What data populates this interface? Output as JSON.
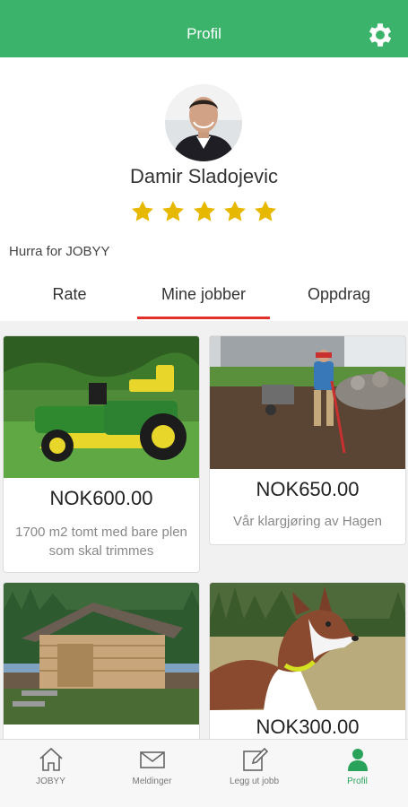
{
  "header": {
    "title": "Profil"
  },
  "profile": {
    "name": "Damir Sladojevic",
    "rating": 5,
    "bio": "Hurra for JOBYY"
  },
  "tabs": [
    {
      "label": "Rate"
    },
    {
      "label": "Mine jobber",
      "active": true
    },
    {
      "label": "Oppdrag"
    }
  ],
  "jobs": [
    {
      "price": "NOK600.00",
      "description": "1700 m2 tomt med bare plen som skal trimmes"
    },
    {
      "price": "NOK650.00",
      "description": "Vår klargjøring av Hagen"
    },
    {
      "price": "",
      "description": ""
    },
    {
      "price": "NOK300.00",
      "description": ""
    }
  ],
  "bottom_nav": [
    {
      "label": "JOBYY",
      "icon": "home-icon"
    },
    {
      "label": "Meldinger",
      "icon": "mail-icon"
    },
    {
      "label": "Legg ut jobb",
      "icon": "edit-icon"
    },
    {
      "label": "Profil",
      "icon": "person-icon",
      "active": true
    }
  ],
  "colors": {
    "primary": "#3bb36a",
    "tab_indicator": "#e0302a",
    "star": "#e6b800"
  }
}
